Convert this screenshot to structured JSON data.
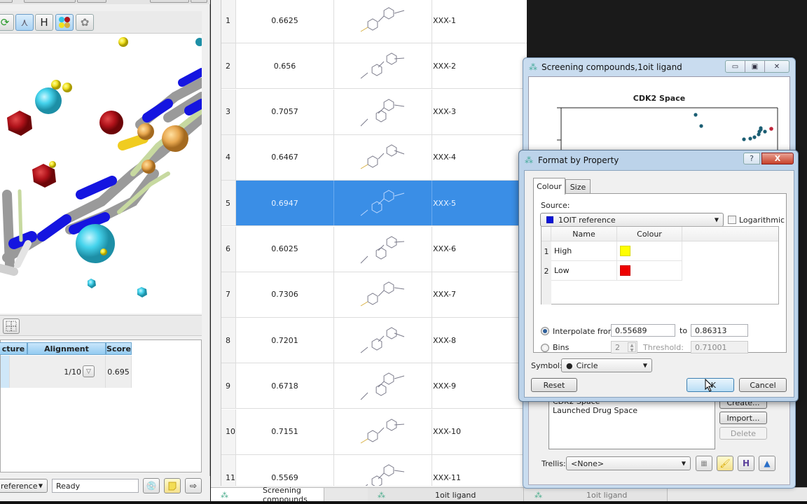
{
  "left_panel": {
    "toolbar": [
      {
        "name": "refresh-icon",
        "glyph": "⟳"
      },
      {
        "name": "wireframe-icon",
        "glyph": "⋏"
      },
      {
        "name": "hydrogen-icon",
        "glyph": "H"
      },
      {
        "name": "atom-colors-icon",
        "glyph": "●"
      },
      {
        "name": "surface-icon",
        "glyph": "✿"
      }
    ],
    "align_table": {
      "headers": [
        "cture",
        "Alignment",
        "Score"
      ],
      "row": {
        "alignment": "1/10",
        "score": "0.695"
      }
    },
    "status": {
      "reference_select": "reference",
      "status_text": "Ready"
    }
  },
  "compounds_table": {
    "rows": [
      {
        "index": "1",
        "score": "0.6625",
        "name": "XXX-1"
      },
      {
        "index": "2",
        "score": "0.656",
        "name": "XXX-2"
      },
      {
        "index": "3",
        "score": "0.7057",
        "name": "XXX-3"
      },
      {
        "index": "4",
        "score": "0.6467",
        "name": "XXX-4"
      },
      {
        "index": "5",
        "score": "0.6947",
        "name": "XXX-5",
        "selected": true
      },
      {
        "index": "6",
        "score": "0.6025",
        "name": "XXX-6"
      },
      {
        "index": "7",
        "score": "0.7306",
        "name": "XXX-7"
      },
      {
        "index": "8",
        "score": "0.7201",
        "name": "XXX-8"
      },
      {
        "index": "9",
        "score": "0.6718",
        "name": "XXX-9"
      },
      {
        "index": "10",
        "score": "0.7151",
        "name": "XXX-10"
      },
      {
        "index": "11",
        "score": "0.5569",
        "name": "XXX-11"
      }
    ],
    "selected_color": "#3a8ee6"
  },
  "bottom_tabs": [
    {
      "label": "Screening compounds",
      "active": true
    },
    {
      "label": "1oit ligand",
      "active": false
    },
    {
      "label": "1oit ligand",
      "active": false
    }
  ],
  "chart_window": {
    "title": "Screening compounds,1oit ligand",
    "chart_title": "CDK2 Space",
    "point_color": "#1b5e73",
    "highlight_color": "#c0253a",
    "spaces_list": [
      "CDK2 Space",
      "Launched Drug Space"
    ],
    "buttons": {
      "create": "Create...",
      "import": "Import...",
      "delete": "Delete"
    },
    "trellis_label": "Trellis:",
    "trellis_value": "<None>"
  },
  "format_dialog": {
    "title": "Format by Property",
    "help": "?",
    "close": "X",
    "tabs": [
      "Colour",
      "Size"
    ],
    "source_label": "Source:",
    "source_value": "1OIT reference",
    "source_color": "#0a14d8",
    "logarithmic_label": "Logarithmic",
    "grid_headers": [
      "Name",
      "Colour"
    ],
    "grid_rows": [
      {
        "index": "1",
        "name": "High",
        "color": "#ffff00"
      },
      {
        "index": "2",
        "name": "Low",
        "color": "#ee0000"
      }
    ],
    "interpolate_label": "Interpolate from",
    "interpolate_from": "0.55689",
    "to_label": "to",
    "interpolate_to": "0.86313",
    "bins_label": "Bins",
    "bins_value": "2",
    "threshold_label": "Threshold:",
    "threshold_value": "0.71001",
    "symbol_label": "Symbol:",
    "symbol_value": "Circle",
    "reset_label": "Reset",
    "ok_label": "OK",
    "cancel_label": "Cancel"
  }
}
